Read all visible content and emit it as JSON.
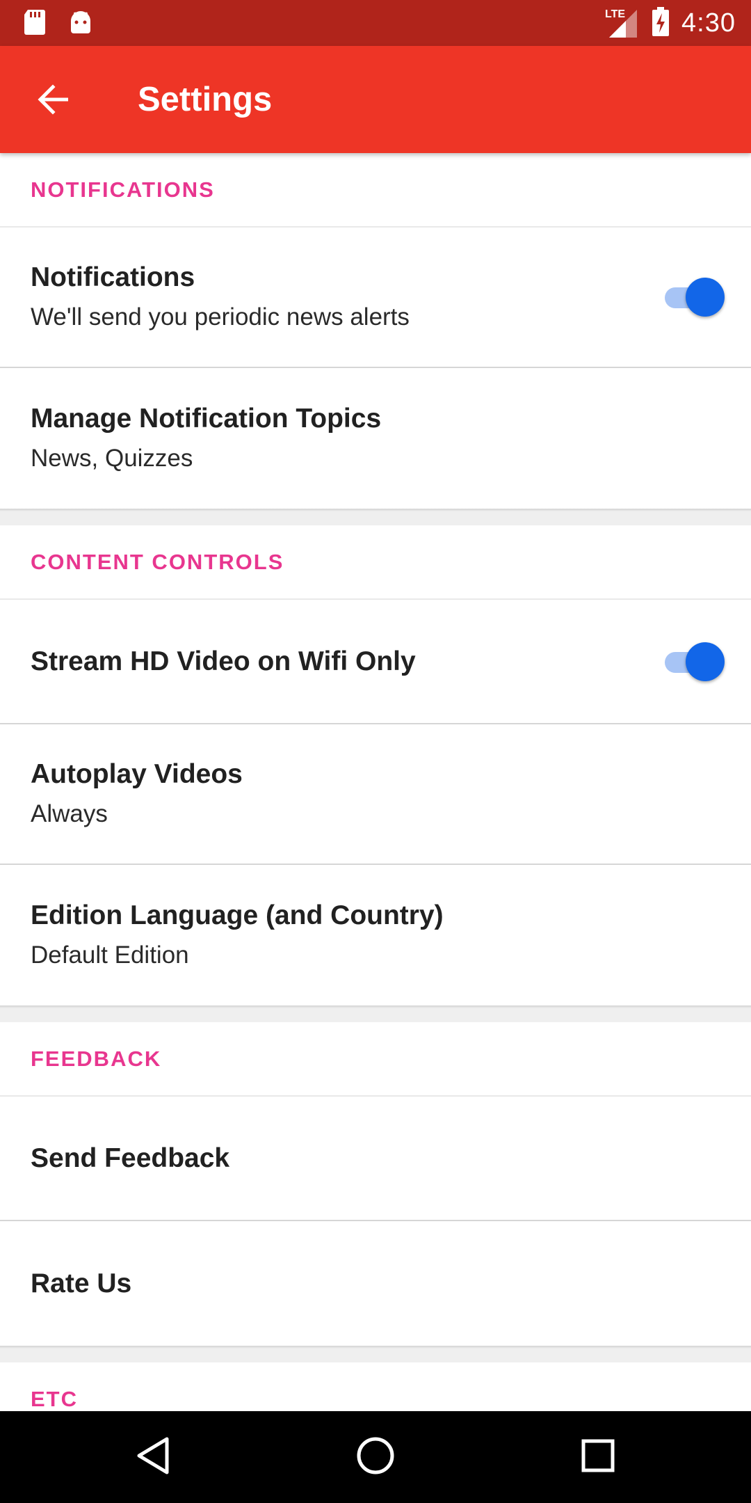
{
  "status_bar": {
    "time": "4:30",
    "network_label": "LTE",
    "icons": [
      "sd-card-icon",
      "android-icon",
      "signal-icon",
      "battery-charging-icon"
    ]
  },
  "app_bar": {
    "title": "Settings",
    "back_icon": "arrow-left-icon"
  },
  "sections": {
    "notifications": {
      "header": "NOTIFICATIONS",
      "items": [
        {
          "title": "Notifications",
          "subtitle": "We'll send you periodic news alerts",
          "toggle_on": true
        },
        {
          "title": "Manage Notification Topics",
          "subtitle": "News, Quizzes"
        }
      ]
    },
    "content_controls": {
      "header": "CONTENT CONTROLS",
      "items": [
        {
          "title": "Stream HD Video on Wifi Only",
          "toggle_on": true
        },
        {
          "title": "Autoplay Videos",
          "subtitle": "Always"
        },
        {
          "title": "Edition Language (and Country)",
          "subtitle": "Default Edition"
        }
      ]
    },
    "feedback": {
      "header": "FEEDBACK",
      "items": [
        {
          "title": "Send Feedback"
        },
        {
          "title": "Rate Us"
        }
      ]
    },
    "etc": {
      "header": "ETC"
    }
  },
  "colors": {
    "status_bar": "#b0241b",
    "app_bar": "#ee3526",
    "section_header": "#e8368f",
    "toggle_thumb": "#1266e8",
    "toggle_track": "#a7c4f5"
  },
  "nav_bar": {
    "icons": [
      "back-triangle-icon",
      "home-circle-icon",
      "recents-square-icon"
    ]
  }
}
